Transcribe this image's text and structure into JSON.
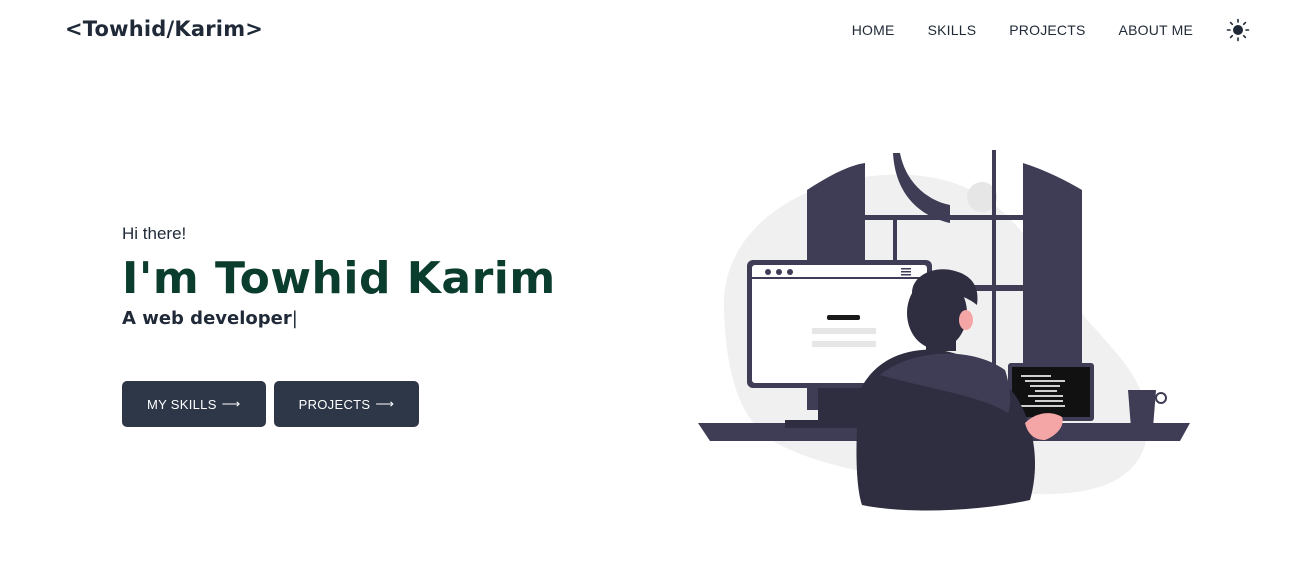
{
  "nav": {
    "logo": "<Towhid/Karim>",
    "links": [
      "HOME",
      "SKILLS",
      "PROJECTS",
      "ABOUT ME"
    ],
    "theme_icon": "sun-icon"
  },
  "hero": {
    "greeting": "Hi there!",
    "name": "I'm Towhid Karim",
    "role": "A web developer",
    "cursor": "|",
    "buttons": [
      {
        "label": "MY SKILLS",
        "arrow": "⟶"
      },
      {
        "label": "PROJECTS",
        "arrow": "⟶"
      }
    ]
  },
  "colors": {
    "name": "#0b3d2e",
    "button_bg": "#2d3748",
    "illustration_dark": "#3f3d56",
    "skin": "#f4a5a5"
  }
}
